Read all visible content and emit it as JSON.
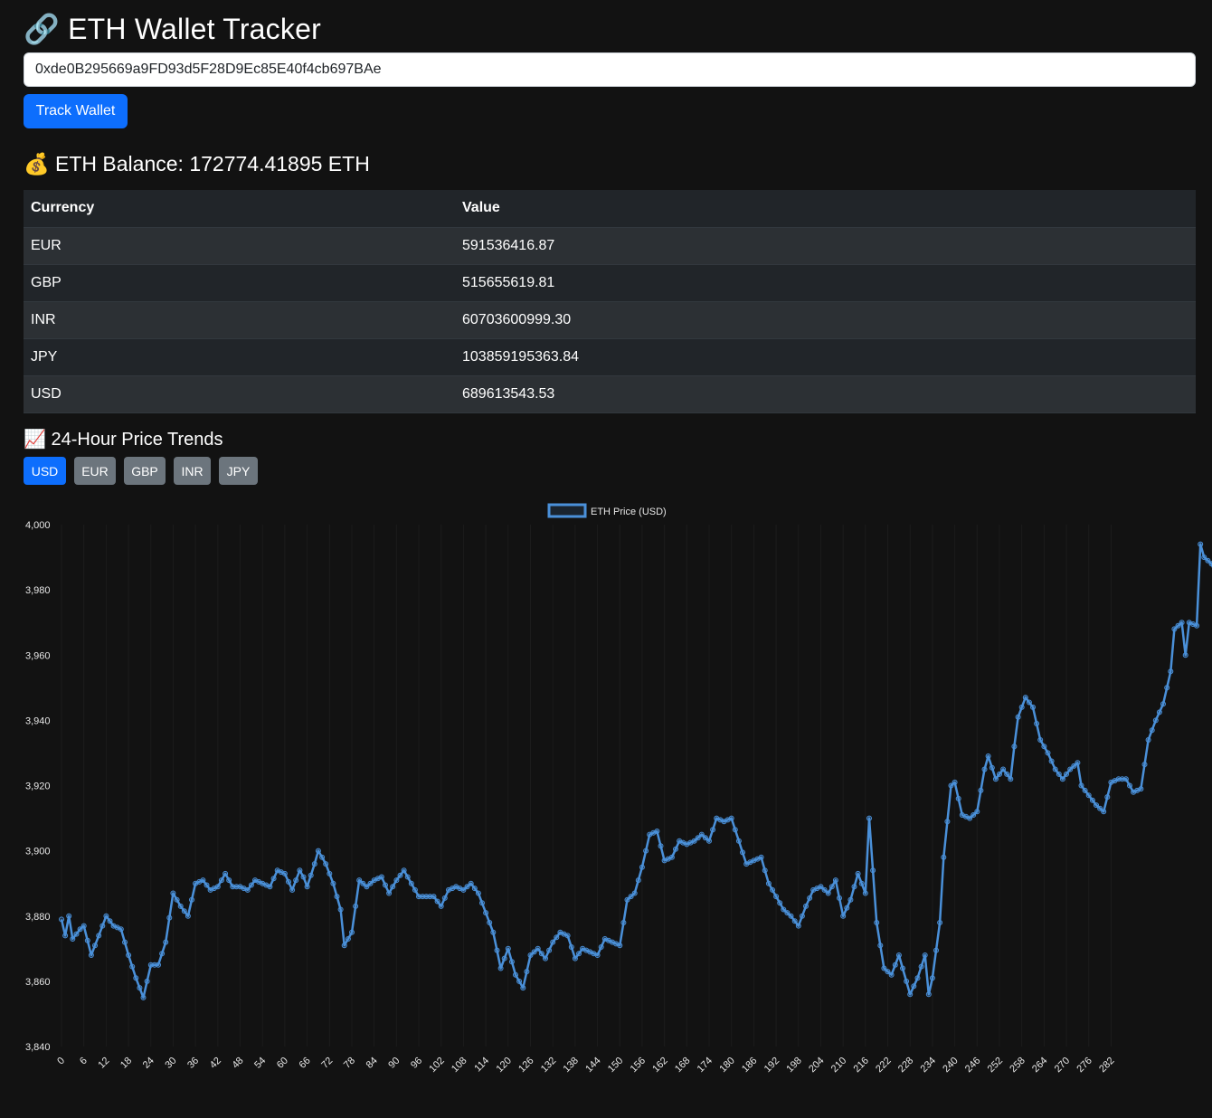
{
  "header": {
    "icon": "link-icon",
    "title": "ETH Wallet Tracker"
  },
  "wallet": {
    "address": "0xde0B295669a9FD93d5F28D9Ec85E40f4cb697BAe",
    "track_label": "Track Wallet"
  },
  "balance": {
    "icon": "money-bag-icon",
    "text": "ETH Balance: 172774.41895 ETH"
  },
  "table": {
    "headers": [
      "Currency",
      "Value"
    ],
    "rows": [
      [
        "EUR",
        "591536416.87"
      ],
      [
        "GBP",
        "515655619.81"
      ],
      [
        "INR",
        "60703600999.30"
      ],
      [
        "JPY",
        "103859195363.84"
      ],
      [
        "USD",
        "689613543.53"
      ]
    ]
  },
  "trends": {
    "icon": "chart-up-icon",
    "title": "24-Hour Price Trends",
    "tabs": [
      "USD",
      "EUR",
      "GBP",
      "INR",
      "JPY"
    ],
    "active": "USD"
  },
  "colors": {
    "accent": "#0d6efd",
    "inactive": "#6c757d",
    "line": "#4a90d9",
    "background": "#121212"
  },
  "chart_data": {
    "type": "line",
    "legend": "ETH Price (USD)",
    "legend_position": "top-center",
    "ylim": [
      3840,
      4000
    ],
    "yticks": [
      3840,
      3860,
      3880,
      3900,
      3920,
      3940,
      3960,
      3980,
      4000
    ],
    "xticks": [
      0,
      6,
      12,
      18,
      24,
      30,
      36,
      42,
      48,
      54,
      60,
      66,
      72,
      78,
      84,
      90,
      96,
      102,
      108,
      114,
      120,
      126,
      132,
      138,
      144,
      150,
      156,
      162,
      168,
      174,
      180,
      186,
      192,
      198,
      204,
      210,
      216,
      222,
      228,
      234,
      240,
      246,
      252,
      258,
      264,
      270,
      276,
      282
    ],
    "x_range": [
      0,
      287
    ],
    "grid": "vertical",
    "anchors": [
      [
        0,
        3879
      ],
      [
        1,
        3874
      ],
      [
        2,
        3880
      ],
      [
        3,
        3873
      ],
      [
        5,
        3876
      ],
      [
        6,
        3877
      ],
      [
        8,
        3868
      ],
      [
        10,
        3874
      ],
      [
        12,
        3880
      ],
      [
        14,
        3877
      ],
      [
        16,
        3876
      ],
      [
        18,
        3868
      ],
      [
        20,
        3861
      ],
      [
        22,
        3855
      ],
      [
        24,
        3865
      ],
      [
        26,
        3865
      ],
      [
        28,
        3872
      ],
      [
        30,
        3887
      ],
      [
        32,
        3883
      ],
      [
        34,
        3880
      ],
      [
        36,
        3890
      ],
      [
        38,
        3891
      ],
      [
        40,
        3888
      ],
      [
        42,
        3889
      ],
      [
        44,
        3893
      ],
      [
        46,
        3889
      ],
      [
        48,
        3889
      ],
      [
        50,
        3888
      ],
      [
        52,
        3891
      ],
      [
        54,
        3890
      ],
      [
        56,
        3889
      ],
      [
        58,
        3894
      ],
      [
        60,
        3893
      ],
      [
        62,
        3888
      ],
      [
        64,
        3894
      ],
      [
        65,
        3892
      ],
      [
        66,
        3889
      ],
      [
        68,
        3896
      ],
      [
        69,
        3900
      ],
      [
        71,
        3896
      ],
      [
        73,
        3890
      ],
      [
        75,
        3882
      ],
      [
        76,
        3871
      ],
      [
        78,
        3875
      ],
      [
        80,
        3891
      ],
      [
        82,
        3889
      ],
      [
        84,
        3891
      ],
      [
        86,
        3892
      ],
      [
        88,
        3887
      ],
      [
        90,
        3891
      ],
      [
        92,
        3894
      ],
      [
        94,
        3890
      ],
      [
        96,
        3886
      ],
      [
        98,
        3886
      ],
      [
        100,
        3886
      ],
      [
        102,
        3883
      ],
      [
        104,
        3888
      ],
      [
        106,
        3889
      ],
      [
        108,
        3888
      ],
      [
        110,
        3890
      ],
      [
        112,
        3887
      ],
      [
        114,
        3881
      ],
      [
        116,
        3875
      ],
      [
        118,
        3864
      ],
      [
        120,
        3870
      ],
      [
        122,
        3862
      ],
      [
        124,
        3858
      ],
      [
        126,
        3868
      ],
      [
        128,
        3870
      ],
      [
        130,
        3867
      ],
      [
        132,
        3872
      ],
      [
        134,
        3875
      ],
      [
        136,
        3874
      ],
      [
        138,
        3867
      ],
      [
        140,
        3870
      ],
      [
        142,
        3869
      ],
      [
        144,
        3868
      ],
      [
        146,
        3873
      ],
      [
        148,
        3872
      ],
      [
        150,
        3871
      ],
      [
        152,
        3885
      ],
      [
        154,
        3887
      ],
      [
        156,
        3895
      ],
      [
        158,
        3905
      ],
      [
        160,
        3906
      ],
      [
        162,
        3897
      ],
      [
        164,
        3898
      ],
      [
        166,
        3903
      ],
      [
        168,
        3902
      ],
      [
        170,
        3903
      ],
      [
        172,
        3905
      ],
      [
        174,
        3903
      ],
      [
        176,
        3910
      ],
      [
        178,
        3909
      ],
      [
        180,
        3910
      ],
      [
        182,
        3903
      ],
      [
        184,
        3896
      ],
      [
        186,
        3897
      ],
      [
        188,
        3898
      ],
      [
        190,
        3890
      ],
      [
        192,
        3886
      ],
      [
        194,
        3882
      ],
      [
        196,
        3880
      ],
      [
        198,
        3877
      ],
      [
        200,
        3883
      ],
      [
        202,
        3888
      ],
      [
        204,
        3889
      ],
      [
        206,
        3887
      ],
      [
        208,
        3891
      ],
      [
        210,
        3880
      ],
      [
        212,
        3885
      ],
      [
        214,
        3893
      ],
      [
        216,
        3887
      ],
      [
        217,
        3910
      ],
      [
        219,
        3878
      ],
      [
        221,
        3864
      ],
      [
        223,
        3862
      ],
      [
        225,
        3868
      ],
      [
        227,
        3860
      ],
      [
        228,
        3856
      ],
      [
        230,
        3861
      ],
      [
        232,
        3868
      ],
      [
        233,
        3856
      ],
      [
        234,
        3861
      ],
      [
        236,
        3878
      ],
      [
        237,
        3898
      ],
      [
        239,
        3920
      ],
      [
        240,
        3921
      ],
      [
        242,
        3911
      ],
      [
        244,
        3910
      ],
      [
        246,
        3912
      ],
      [
        248,
        3925
      ],
      [
        249,
        3929
      ],
      [
        251,
        3922
      ],
      [
        253,
        3925
      ],
      [
        255,
        3922
      ],
      [
        256,
        3932
      ],
      [
        257,
        3941
      ],
      [
        259,
        3947
      ],
      [
        261,
        3944
      ],
      [
        263,
        3934
      ],
      [
        265,
        3930
      ],
      [
        267,
        3925
      ],
      [
        269,
        3922
      ],
      [
        271,
        3925
      ],
      [
        273,
        3927
      ],
      [
        274,
        3920
      ],
      [
        276,
        3917
      ],
      [
        278,
        3914
      ],
      [
        280,
        3912
      ],
      [
        282,
        3921
      ],
      [
        284,
        3922
      ],
      [
        286,
        3922
      ],
      [
        288,
        3918
      ],
      [
        290,
        3919
      ],
      [
        292,
        3934
      ],
      [
        294,
        3940
      ],
      [
        296,
        3945
      ],
      [
        298,
        3955
      ],
      [
        299,
        3968
      ],
      [
        301,
        3970
      ],
      [
        302,
        3960
      ],
      [
        303,
        3970
      ],
      [
        305,
        3969
      ],
      [
        306,
        3994
      ],
      [
        307,
        3990
      ],
      [
        309,
        3988
      ],
      [
        310,
        3985
      ],
      [
        311,
        3980
      ],
      [
        313,
        3982
      ],
      [
        314,
        3983
      ]
    ]
  }
}
